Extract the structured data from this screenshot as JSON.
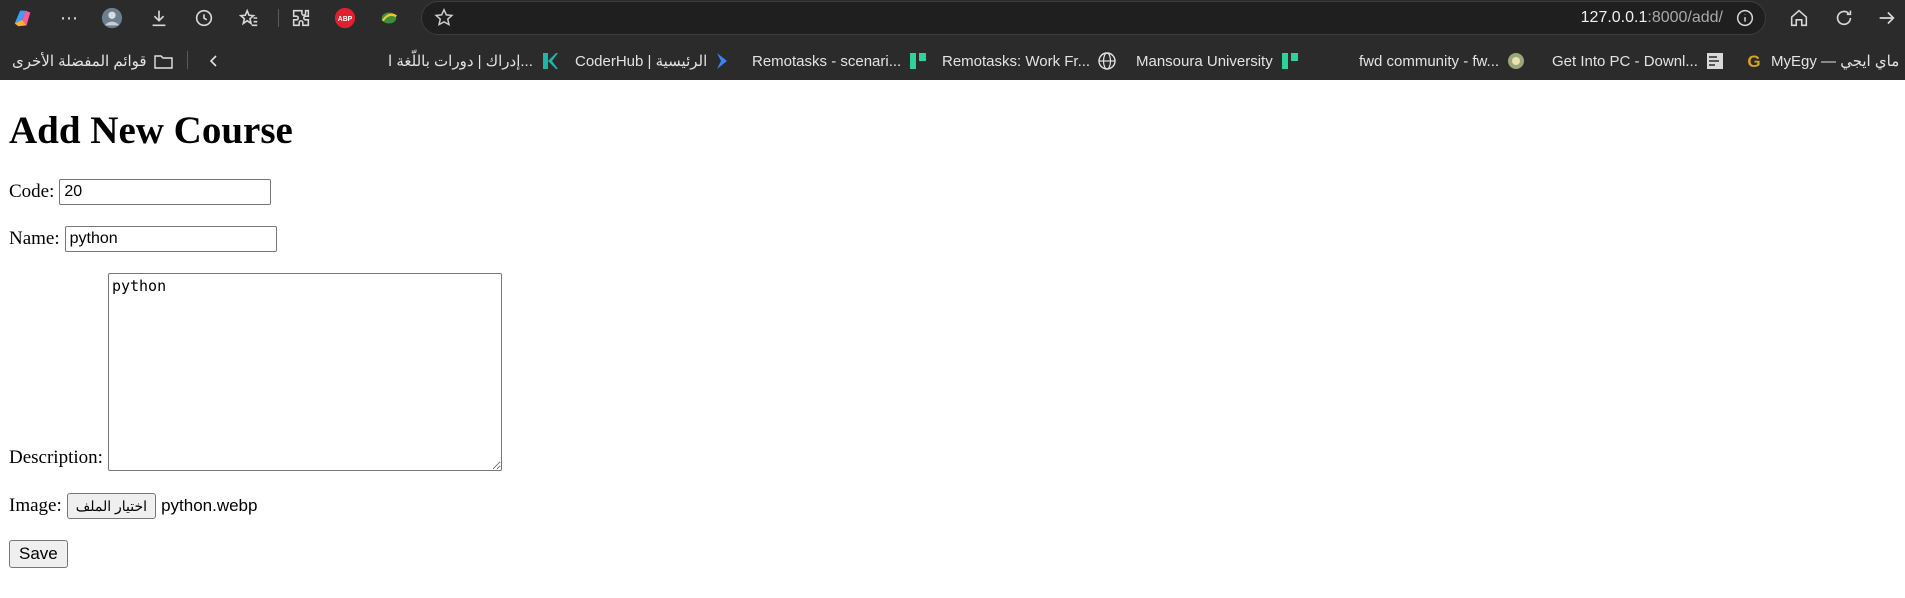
{
  "browser": {
    "url_host": "127.0.0.1",
    "url_rest": ":8000/add/",
    "toolbar_icons": [
      "copilot-icon",
      "more-icon",
      "profile-avatar",
      "download-icon",
      "history-icon",
      "favorites-icon",
      "extensions-icon",
      "adblock-icon",
      "extension-icon",
      "star-icon",
      "site-info-icon",
      "home-icon",
      "refresh-icon",
      "forward-icon"
    ],
    "adblock_label": "ABP",
    "bookmarks": [
      {
        "label": "قوائم المفضلة الأخرى",
        "icon": "folder-icon"
      },
      {
        "label": "إدراك | دورات باللّغة ا...",
        "icon": "edraak-icon",
        "color": "#1fb5a8"
      },
      {
        "label": "CoderHub | الرئيسية",
        "icon": "coderhub-icon",
        "color": "#3b82f6"
      },
      {
        "label": "Remotasks - scenari...",
        "icon": "remotasks-icon",
        "color": "#2fd39a"
      },
      {
        "label": "Remotasks: Work Fr...",
        "icon": "globe-icon"
      },
      {
        "label": "Mansoura University",
        "icon": "remotasks-icon",
        "color": "#2fd39a"
      },
      {
        "label": "fwd community - fw...",
        "icon": "mansoura-icon",
        "color": "#9aa77a"
      },
      {
        "label": "Get Into PC - Downl...",
        "icon": "fwd-icon",
        "color": "#d9d9d9"
      },
      {
        "label": "MyEgy — ماي ايجي",
        "icon": "getintopc-icon",
        "color": "#d8a21b"
      }
    ],
    "last_favicon_color": "#ff7a1a"
  },
  "form": {
    "title": "Add New Course",
    "code_label": "Code:",
    "code_value": "20",
    "name_label": "Name:",
    "name_value": "python",
    "description_label": "Description:",
    "description_value": "python",
    "image_label": "Image:",
    "file_button_label": "اختيار الملف",
    "file_name": "python.webp",
    "save_label": "Save"
  }
}
